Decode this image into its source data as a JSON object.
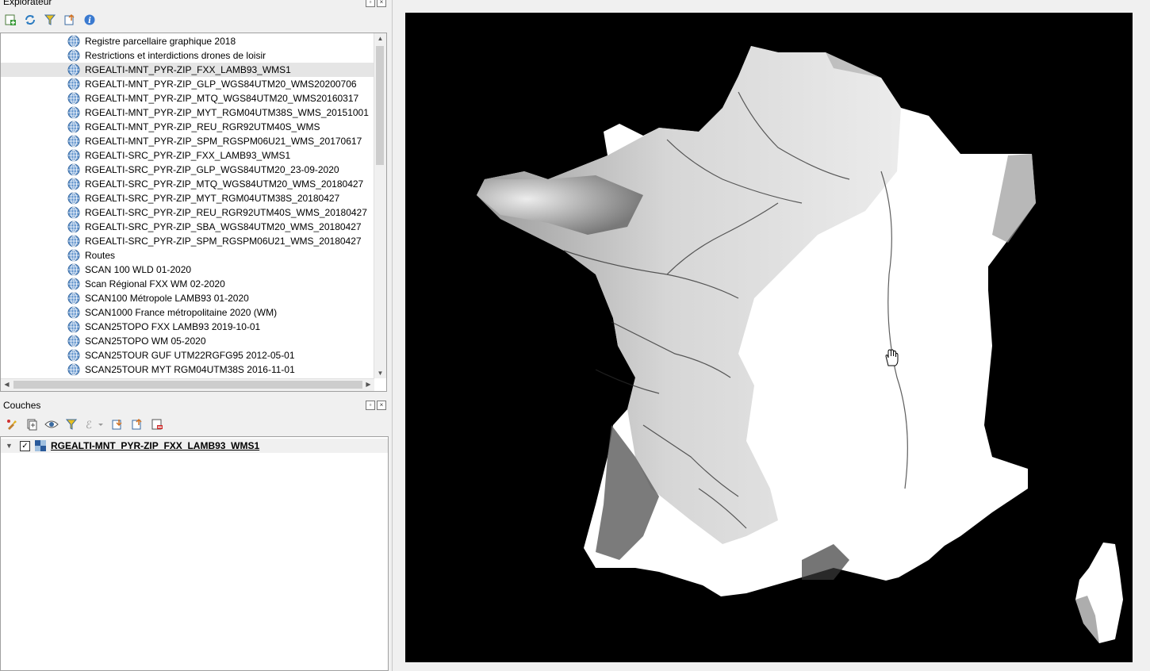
{
  "explorer": {
    "title": "Explorateur",
    "toolbar": [
      "add-layer-icon",
      "refresh-icon",
      "filter-icon",
      "collapse-all-icon",
      "info-icon"
    ],
    "items": [
      {
        "label": "Registre parcellaire graphique 2018"
      },
      {
        "label": "Restrictions et interdictions drones de loisir"
      },
      {
        "label": "RGEALTI-MNT_PYR-ZIP_FXX_LAMB93_WMS1",
        "selected": true
      },
      {
        "label": "RGEALTI-MNT_PYR-ZIP_GLP_WGS84UTM20_WMS20200706"
      },
      {
        "label": "RGEALTI-MNT_PYR-ZIP_MTQ_WGS84UTM20_WMS20160317"
      },
      {
        "label": "RGEALTI-MNT_PYR-ZIP_MYT_RGM04UTM38S_WMS_20151001"
      },
      {
        "label": "RGEALTI-MNT_PYR-ZIP_REU_RGR92UTM40S_WMS"
      },
      {
        "label": "RGEALTI-MNT_PYR-ZIP_SPM_RGSPM06U21_WMS_20170617"
      },
      {
        "label": "RGEALTI-SRC_PYR-ZIP_FXX_LAMB93_WMS1"
      },
      {
        "label": "RGEALTI-SRC_PYR-ZIP_GLP_WGS84UTM20_23-09-2020"
      },
      {
        "label": "RGEALTI-SRC_PYR-ZIP_MTQ_WGS84UTM20_WMS_20180427"
      },
      {
        "label": "RGEALTI-SRC_PYR-ZIP_MYT_RGM04UTM38S_20180427"
      },
      {
        "label": "RGEALTI-SRC_PYR-ZIP_REU_RGR92UTM40S_WMS_20180427"
      },
      {
        "label": "RGEALTI-SRC_PYR-ZIP_SBA_WGS84UTM20_WMS_20180427"
      },
      {
        "label": "RGEALTI-SRC_PYR-ZIP_SPM_RGSPM06U21_WMS_20180427"
      },
      {
        "label": "Routes"
      },
      {
        "label": "SCAN 100 WLD 01-2020"
      },
      {
        "label": "Scan Régional FXX WM 02-2020"
      },
      {
        "label": "SCAN100 Métropole LAMB93 01-2020"
      },
      {
        "label": "SCAN1000 France métropolitaine 2020 (WM)"
      },
      {
        "label": "SCAN25TOPO FXX LAMB93 2019-10-01"
      },
      {
        "label": "SCAN25TOPO WM 05-2020"
      },
      {
        "label": "SCAN25TOUR GUF UTM22RGFG95 2012-05-01"
      },
      {
        "label": "SCAN25TOUR MYT RGM04UTM38S 2016-11-01"
      }
    ]
  },
  "layers": {
    "title": "Couches",
    "toolbar": [
      "style-icon",
      "add-group-icon",
      "visibility-icon",
      "filter-icon",
      "expression-icon",
      "expand-all-icon",
      "collapse-all-icon",
      "remove-layer-icon"
    ],
    "items": [
      {
        "label": "RGEALTI-MNT_PYR-ZIP_FXX_LAMB93_WMS1",
        "checked": true
      }
    ]
  },
  "map": {
    "background": "#000000",
    "land": "#ffffff",
    "cursor": "pan-hand-icon"
  }
}
